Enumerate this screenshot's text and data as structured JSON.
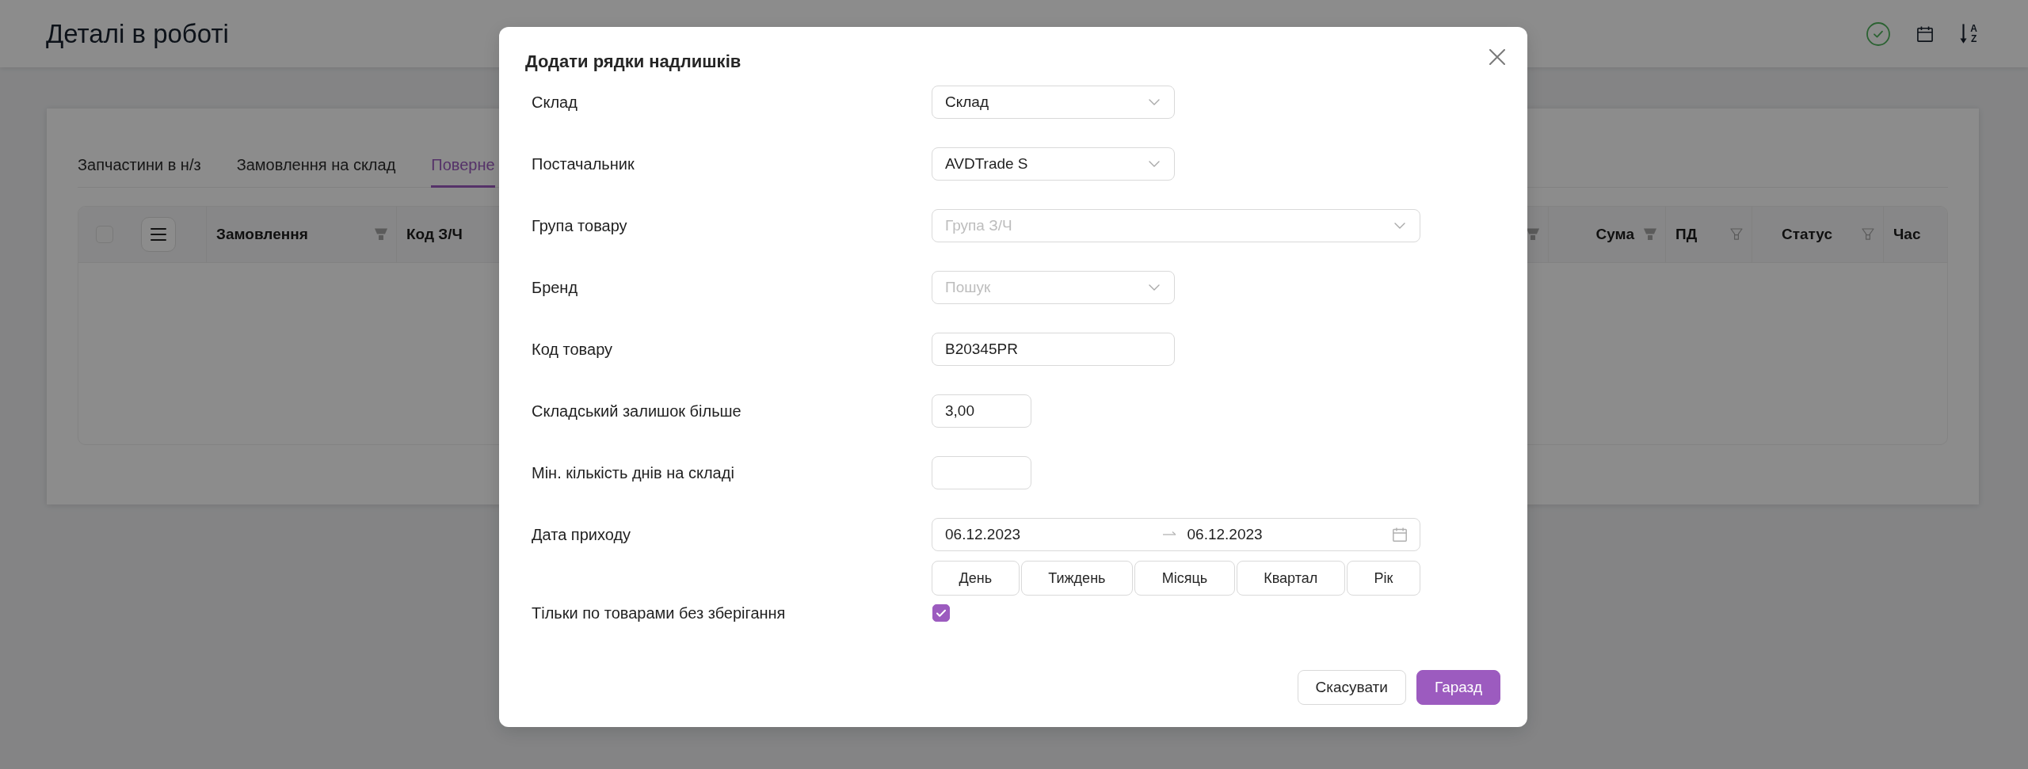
{
  "page": {
    "title": "Деталі в роботі"
  },
  "toolbar": [
    {
      "kind": "status"
    },
    {
      "kind": "calendar"
    },
    {
      "kind": "sort",
      "top": "A",
      "bottom": "Z"
    }
  ],
  "tabs": [
    {
      "label": "Запчастини в н/з",
      "selected": false
    },
    {
      "label": "Замовлення на склад",
      "selected": false
    },
    {
      "label": "Поверне",
      "selected": true
    }
  ],
  "table": {
    "select_all": {
      "checked": false
    },
    "columns": [
      {
        "label": "Замовлення",
        "kind": "filter_filled"
      },
      {
        "label": "Код З/Ч",
        "kind": "plain"
      },
      {
        "kind": "filter_filled"
      },
      {
        "label": "Сума",
        "kind": "filter_filled"
      },
      {
        "label": "ПД",
        "kind": "filter_outline"
      },
      {
        "label": "Статус",
        "kind": "filter_outline"
      },
      {
        "label": "Час",
        "kind": "plain"
      }
    ]
  },
  "dialog": {
    "title": "Додати рядки надлишків",
    "fields": [
      {
        "kind": "select",
        "label": "Склад",
        "value": "Склад"
      },
      {
        "kind": "select",
        "label": "Постачальник",
        "value": "AVDTrade S"
      },
      {
        "kind": "select",
        "label": "Група товару",
        "placeholder": "Група З/Ч"
      },
      {
        "kind": "select",
        "label": "Бренд",
        "placeholder": "Пошук"
      },
      {
        "kind": "text",
        "label": "Код товару",
        "value": "B20345PR"
      },
      {
        "kind": "number",
        "label": "Складський залишок більше",
        "value": "3,00"
      },
      {
        "kind": "number",
        "label": "Мін. кількість днів на складі"
      },
      {
        "kind": "date_range",
        "label": "Дата приходу",
        "from": "06.12.2023",
        "to": "06.12.2023",
        "presets": [
          {
            "label": "День",
            "selected": false
          },
          {
            "label": "Тиждень",
            "selected": false
          },
          {
            "label": "Місяць",
            "selected": false
          },
          {
            "label": "Квартал",
            "selected": false
          },
          {
            "label": "Рік",
            "selected": false
          }
        ]
      },
      {
        "kind": "checkbox",
        "label": "Тільки по товарами без зберігання",
        "checked": true
      }
    ],
    "buttons": [
      {
        "label": "Скасувати",
        "kind": "default"
      },
      {
        "label": "Гаразд",
        "kind": "primary"
      }
    ]
  }
}
